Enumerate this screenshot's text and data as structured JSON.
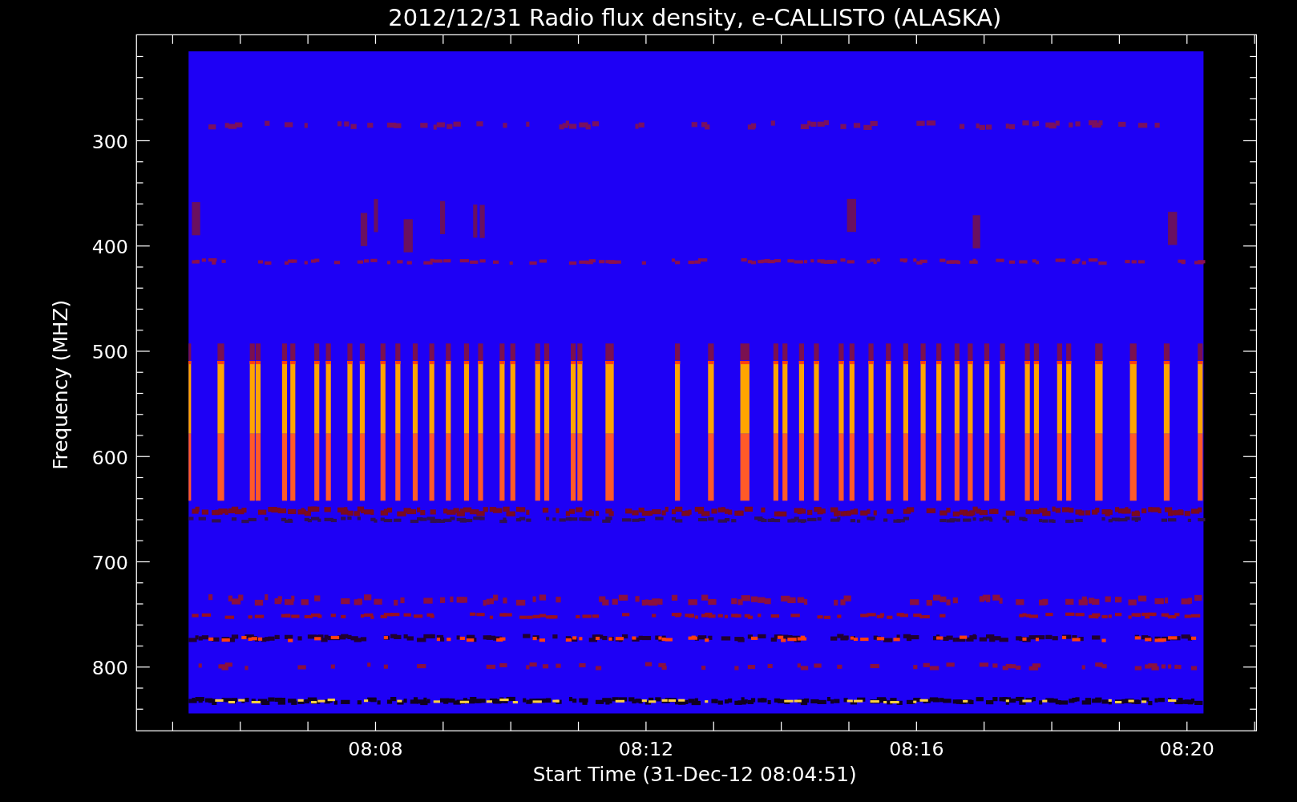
{
  "chart": {
    "title": "2012/12/31  Radio flux density, e-CALLISTO (ALASKA)",
    "xlabel": "Start Time (31-Dec-12 08:04:51)",
    "ylabel": "Frequency (MHZ)",
    "yticks": [
      "300",
      "400",
      "500",
      "600",
      "700",
      "800"
    ],
    "xticks": [
      "08:08",
      "08:12",
      "08:16",
      "08:20"
    ]
  }
}
